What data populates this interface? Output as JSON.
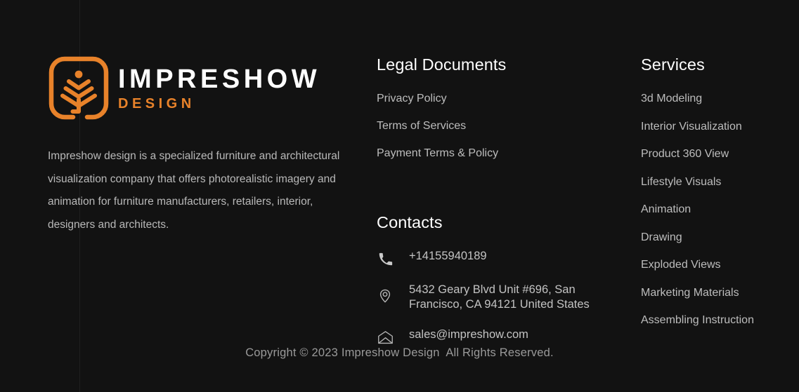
{
  "theme": {
    "background": "#121212",
    "accent_orange": "#e8822a",
    "heading_color": "#ffffff",
    "link_color": "#bdbdbd",
    "body_text_color": "#b9b9b9",
    "copyright_color": "#9a9a9a"
  },
  "brand": {
    "logo_icon": "impreshow-plant-logo-icon",
    "name_main": "IMPRESHOW",
    "name_sub": "DESIGN",
    "description": "Impreshow design is a specialized furniture and architectural visualization company that offers photorealistic imagery and animation for furniture manufacturers, retailers, interior, designers and architects."
  },
  "legal": {
    "title": "Legal Documents",
    "items": [
      {
        "label": "Privacy Policy"
      },
      {
        "label": "Terms of Services"
      },
      {
        "label": "Payment Terms & Policy"
      }
    ]
  },
  "contacts": {
    "title": "Contacts",
    "items": [
      {
        "icon": "phone-icon",
        "label": "+14155940189"
      },
      {
        "icon": "location-pin-icon",
        "label": "5432 Geary Blvd Unit #696, San Francisco, CA 94121 United States"
      },
      {
        "icon": "envelope-icon",
        "label": "sales@impreshow.com"
      }
    ]
  },
  "services": {
    "title": "Services",
    "items": [
      {
        "label": "3d Modeling"
      },
      {
        "label": "Interior Visualization"
      },
      {
        "label": "Product 360 View"
      },
      {
        "label": "Lifestyle Visuals"
      },
      {
        "label": "Animation"
      },
      {
        "label": "Drawing"
      },
      {
        "label": "Exploded Views"
      },
      {
        "label": "Marketing Materials"
      },
      {
        "label": "Assembling Instruction"
      }
    ]
  },
  "copyright": {
    "text": "Copyright © 2023 Impreshow Design  All Rights Reserved."
  }
}
